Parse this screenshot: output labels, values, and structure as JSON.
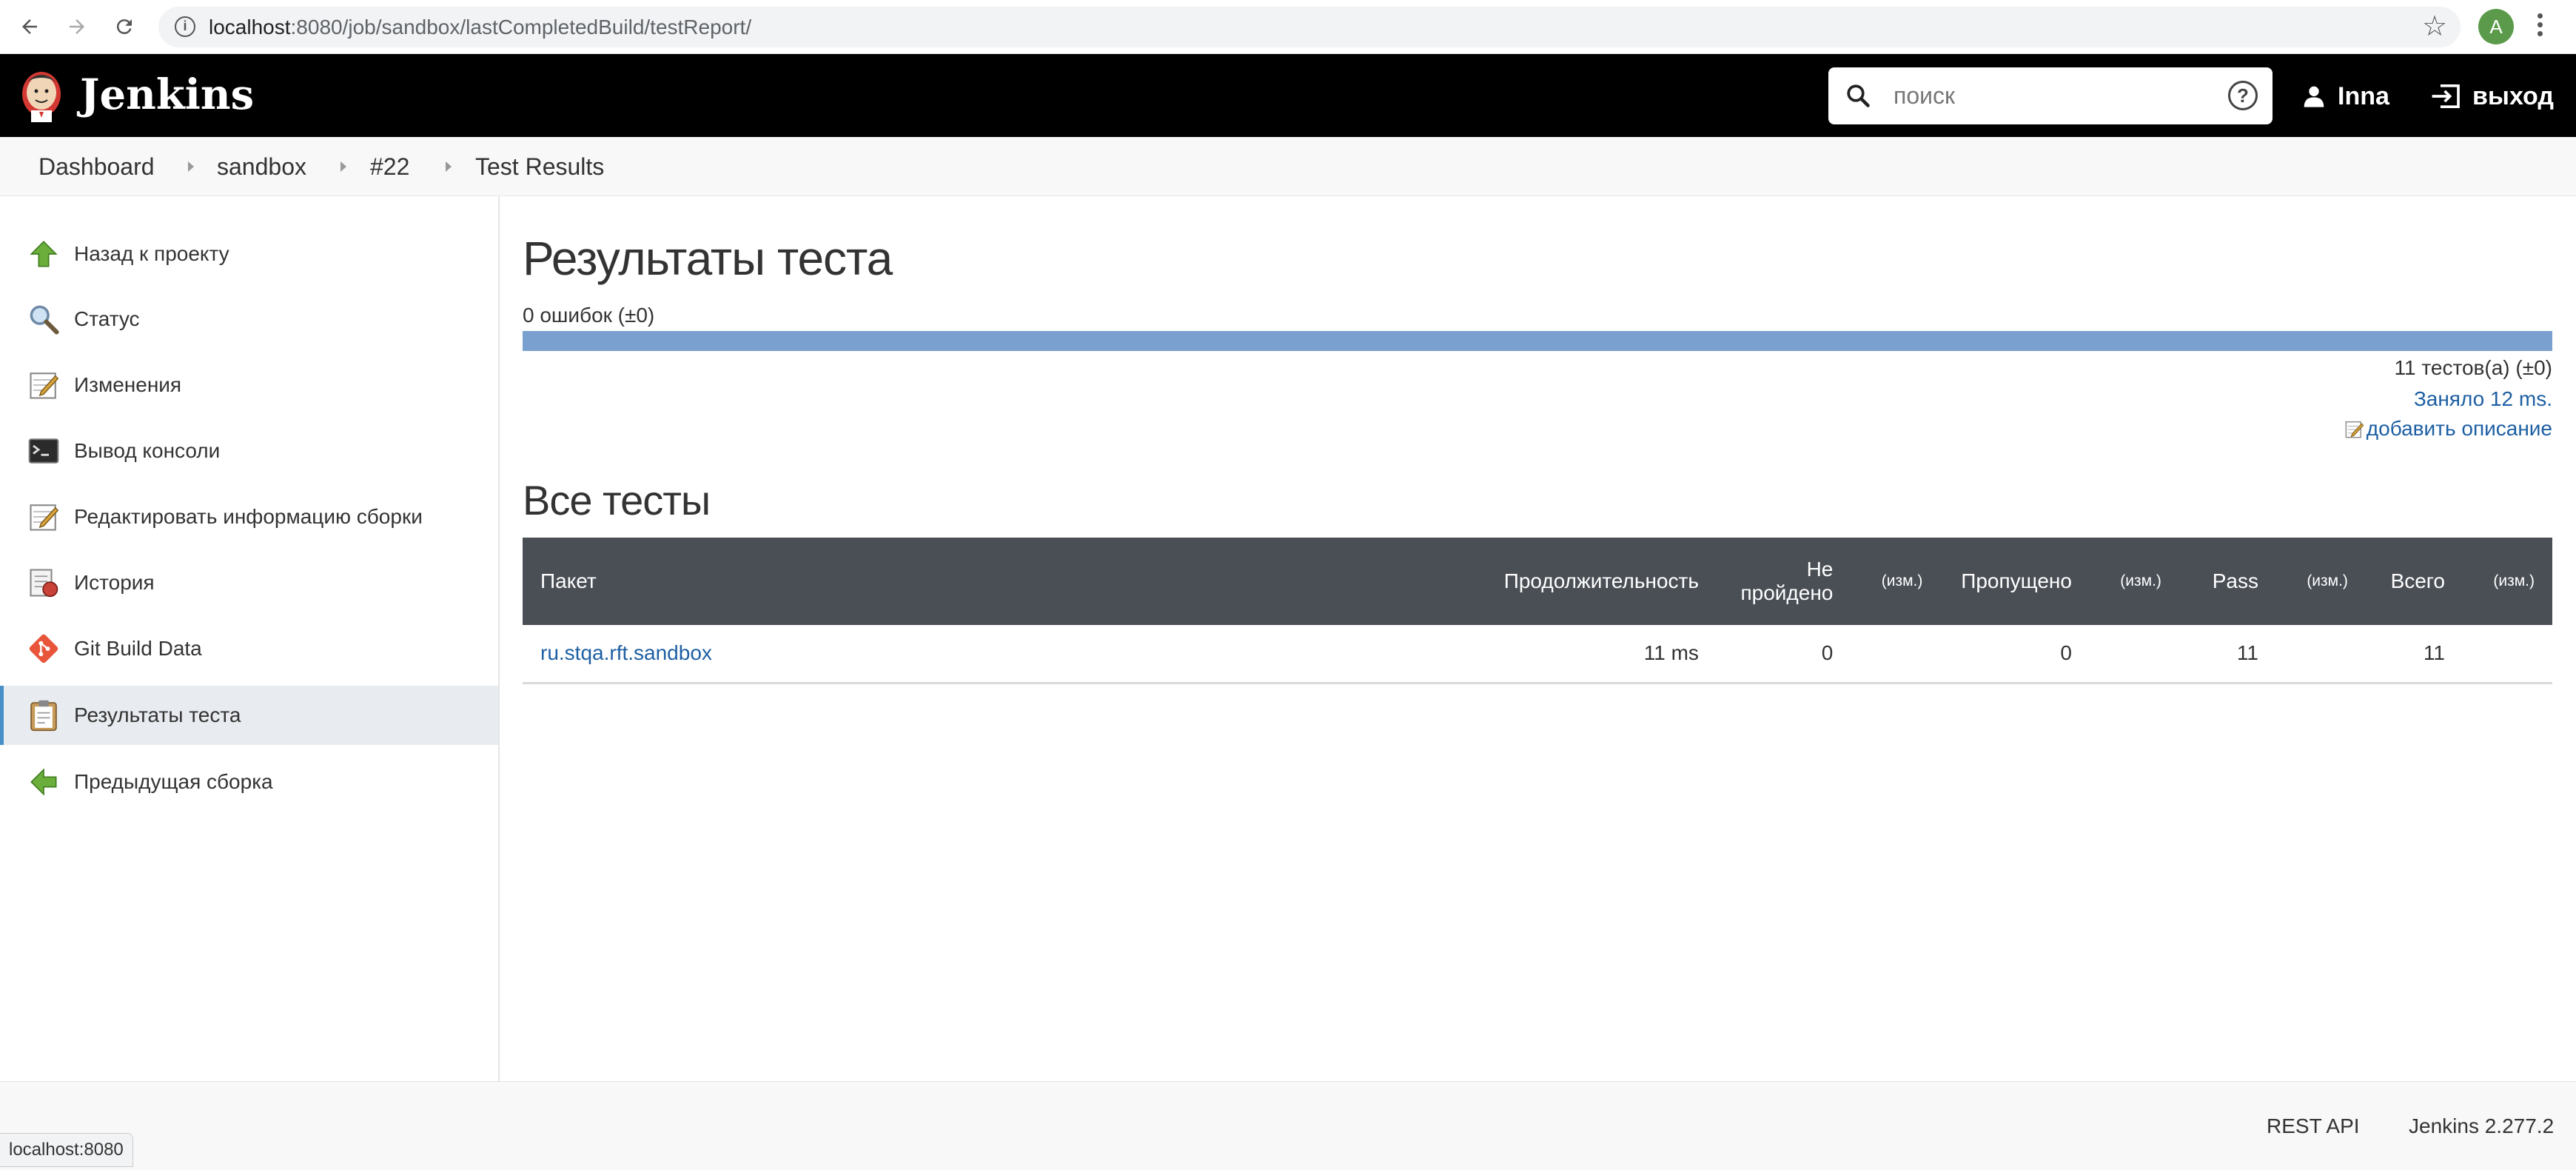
{
  "browser": {
    "url_host": "localhost",
    "url_rest": ":8080/job/sandbox/lastCompletedBuild/testReport/",
    "profile_initial": "A"
  },
  "header": {
    "logo_text": "Jenkins",
    "search_placeholder": "поиск",
    "help": "?",
    "user": "Inna",
    "logout": "выход"
  },
  "breadcrumb": [
    "Dashboard",
    "sandbox",
    "#22",
    "Test Results"
  ],
  "sidebar": {
    "items": [
      {
        "label": "Назад к проекту",
        "icon": "up-arrow-icon"
      },
      {
        "label": "Статус",
        "icon": "magnifier-icon"
      },
      {
        "label": "Изменения",
        "icon": "notepad-icon"
      },
      {
        "label": "Вывод консоли",
        "icon": "terminal-icon"
      },
      {
        "label": "Редактировать информацию сборки",
        "icon": "notepad-icon"
      },
      {
        "label": "История",
        "icon": "history-icon"
      },
      {
        "label": "Git Build Data",
        "icon": "git-icon"
      },
      {
        "label": "Результаты теста",
        "icon": "clipboard-icon"
      },
      {
        "label": "Предыдущая сборка",
        "icon": "left-arrow-icon"
      }
    ],
    "active_index": 7
  },
  "main": {
    "title": "Результаты теста",
    "failures": "0 ошибок (±0)",
    "pass_fraction": 1.0,
    "tests_count": "11 тестов(а) (±0)",
    "took": "Заняло 12 ms.",
    "add_description": "добавить описание",
    "all_tests_title": "Все тесты"
  },
  "table": {
    "headers": {
      "package": "Пакет",
      "duration": "Продолжительность",
      "failed_line1": "Не",
      "failed_line2": "пройдено",
      "diff": "(изм.)",
      "skipped": "Пропущено",
      "pass": "Pass",
      "total": "Всего"
    },
    "rows": [
      {
        "package": "ru.stqa.rft.sandbox",
        "duration": "11 ms",
        "failed": "0",
        "failed_diff": "",
        "skipped": "0",
        "skipped_diff": "",
        "pass": "11",
        "pass_diff": "",
        "total": "11",
        "total_diff": ""
      }
    ]
  },
  "footer": {
    "rest_api": "REST API",
    "version": "Jenkins 2.277.2"
  },
  "statusbar": "localhost:8080",
  "colors": {
    "header_bg": "#000000",
    "progress_pass": "#7aa0d0",
    "link": "#1d5fa3",
    "table_header_bg": "#4a4f56"
  }
}
